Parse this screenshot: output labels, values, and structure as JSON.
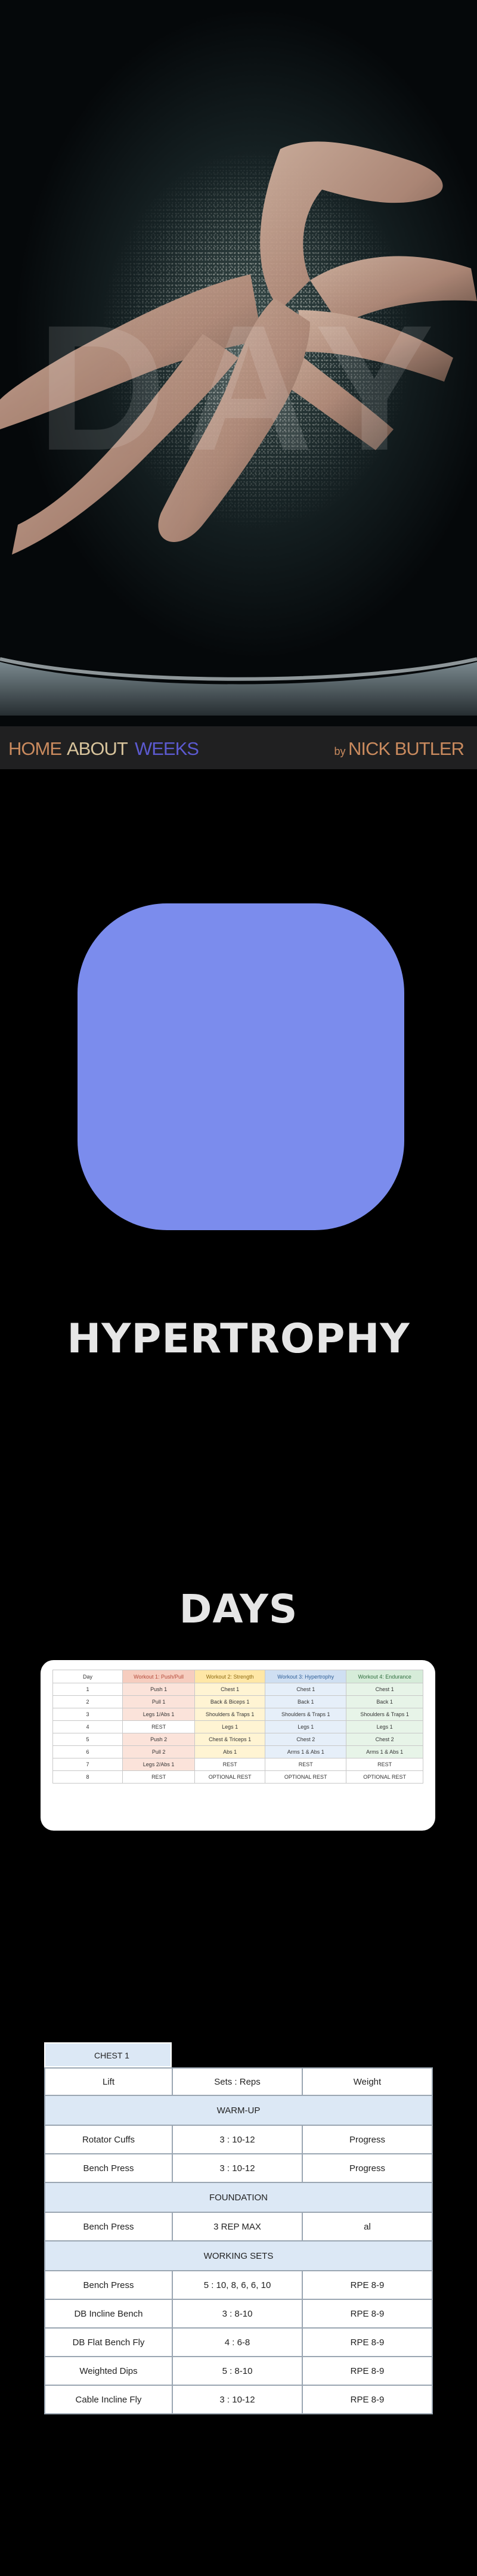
{
  "hero": {
    "watermark": "DAY",
    "nav": {
      "home": "HOME",
      "about": "ABOUT",
      "weeks": "WEEKS",
      "by_prefix": "by",
      "author": "NICK BUTLER"
    }
  },
  "logo": {
    "color": "#7b8ced"
  },
  "headings": {
    "main": "HYPERTROPHY",
    "days": "DAYS"
  },
  "days_table": {
    "headers": [
      "Day",
      "Workout 1: Push/Pull",
      "Workout 2: Strength",
      "Workout 3: Hypertrophy",
      "Workout 4: Endurance"
    ],
    "rows": [
      [
        "1",
        "Push 1",
        "Chest 1",
        "Chest 1",
        "Chest 1"
      ],
      [
        "2",
        "Pull 1",
        "Back & Biceps 1",
        "Back 1",
        "Back 1"
      ],
      [
        "3",
        "Legs 1/Abs 1",
        "Shoulders & Traps 1",
        "Shoulders & Traps 1",
        "Shoulders & Traps 1"
      ],
      [
        "4",
        "REST",
        "Legs 1",
        "Legs 1",
        "Legs 1"
      ],
      [
        "5",
        "Push 2",
        "Chest & Triceps 1",
        "Chest 2",
        "Chest 2"
      ],
      [
        "6",
        "Pull 2",
        "Abs 1",
        "Arms 1 & Abs 1",
        "Arms 1 & Abs 1"
      ],
      [
        "7",
        "Legs 2/Abs 1",
        "REST",
        "REST",
        "REST"
      ],
      [
        "8",
        "REST",
        "OPTIONAL REST",
        "OPTIONAL REST",
        "OPTIONAL REST"
      ]
    ]
  },
  "chest_table": {
    "tab": "CHEST 1",
    "headers": [
      "Lift",
      "Sets : Reps",
      "Weight"
    ],
    "warmup_label": "WARM-UP",
    "warmup": [
      [
        "Rotator Cuffs",
        "3 : 10-12",
        "Progress"
      ],
      [
        "Bench Press",
        "3 : 10-12",
        "Progress"
      ]
    ],
    "foundation_label": "FOUNDATION",
    "foundation": [
      [
        "Bench Press",
        "3 REP MAX",
        "al"
      ]
    ],
    "working_label": "WORKING SETS",
    "working": [
      [
        "Bench Press",
        "5 : 10, 8, 6, 6, 10",
        "RPE 8-9"
      ],
      [
        "DB Incline Bench",
        "3 : 8-10",
        "RPE 8-9"
      ],
      [
        "DB Flat Bench Fly",
        "4 : 6-8",
        "RPE 8-9"
      ],
      [
        "Weighted Dips",
        "5 : 8-10",
        "RPE 8-9"
      ],
      [
        "Cable Incline Fly",
        "3 : 10-12",
        "RPE 8-9"
      ]
    ]
  }
}
